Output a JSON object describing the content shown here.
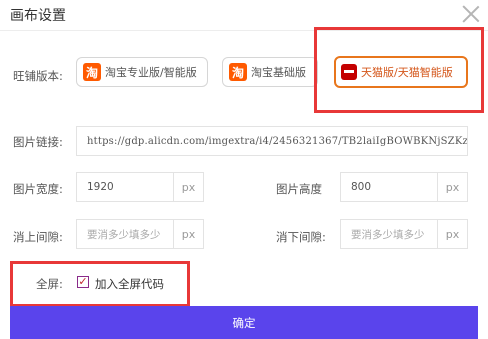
{
  "dialog": {
    "title": "画布设置",
    "close_icon": "close-icon"
  },
  "version": {
    "label": "旺铺版本:",
    "options": [
      {
        "label": "淘宝专业版/智能版",
        "icon": "taobao-logo-icon",
        "selected": false
      },
      {
        "label": "淘宝基础版",
        "icon": "taobao-logo-icon",
        "selected": false
      },
      {
        "label": "天猫版/天猫智能版",
        "icon": "tmall-logo-icon",
        "selected": true
      }
    ]
  },
  "image_link": {
    "label": "图片链接:",
    "value": "https://gdp.alicdn.com/imgextra/i4/2456321367/TB2laiIgBOWBKNjSZKz"
  },
  "image_width": {
    "label": "图片宽度:",
    "value": "1920",
    "unit": "px"
  },
  "image_height": {
    "label": "图片高度",
    "value": "800",
    "unit": "px"
  },
  "top_gap": {
    "label": "消上间隙:",
    "placeholder": "要消多少填多少",
    "unit": "px"
  },
  "bottom_gap": {
    "label": "消下间隙:",
    "placeholder": "要消多少填多少",
    "unit": "px"
  },
  "fullscreen": {
    "label": "全屏:",
    "checkbox_label": "加入全屏代码",
    "checked": true
  },
  "submit": {
    "label": "确定"
  },
  "colors": {
    "accent": "#5a44ec",
    "highlight": "#e83838",
    "selected_border": "#e8761c"
  }
}
